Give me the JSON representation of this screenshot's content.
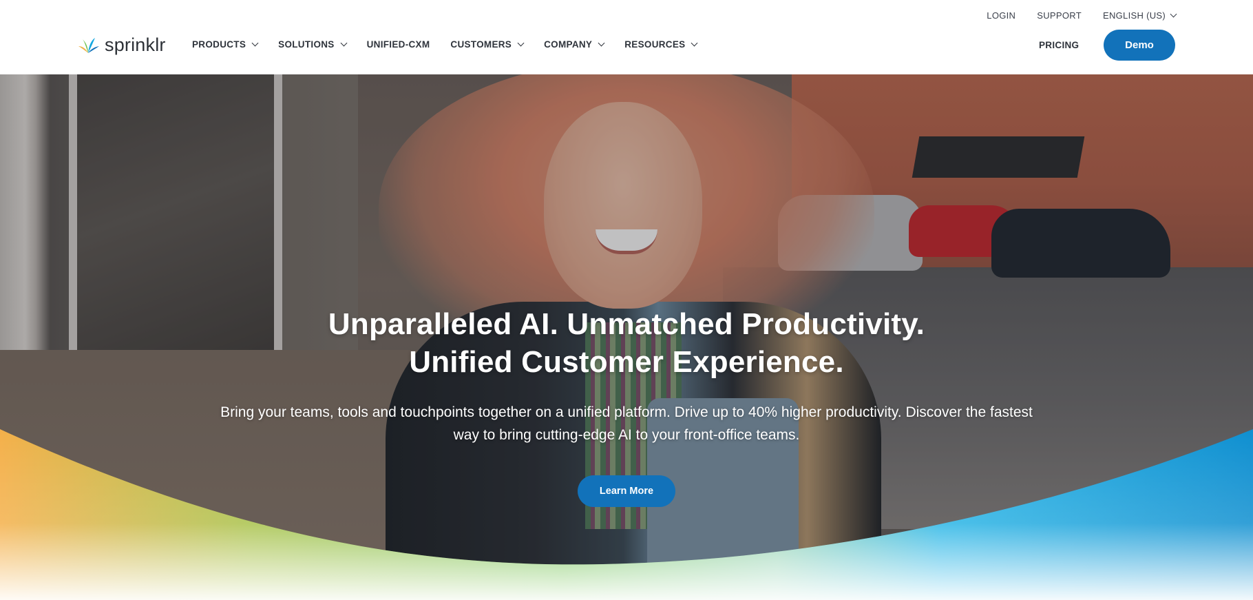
{
  "brand": {
    "name": "sprinklr"
  },
  "topbar": {
    "login": "LOGIN",
    "support": "SUPPORT",
    "language": "ENGLISH (US)"
  },
  "nav": {
    "items": [
      {
        "label": "PRODUCTS",
        "dropdown": true
      },
      {
        "label": "SOLUTIONS",
        "dropdown": true
      },
      {
        "label": "UNIFIED-CXM",
        "dropdown": false
      },
      {
        "label": "CUSTOMERS",
        "dropdown": true
      },
      {
        "label": "COMPANY",
        "dropdown": true
      },
      {
        "label": "RESOURCES",
        "dropdown": true
      }
    ],
    "pricing": "PRICING",
    "demo": "Demo"
  },
  "hero": {
    "headline_line1": "Unparalleled AI. Unmatched Productivity.",
    "headline_line2": "Unified Customer Experience.",
    "subtext": "Bring your teams, tools and touchpoints together on a unified platform. Drive up to 40% higher productivity. Discover the fastest way to bring cutting-edge AI to your front-office teams.",
    "cta": "Learn More"
  },
  "colors": {
    "primary": "#1272ba",
    "wave_orange": "#f0b34a",
    "wave_green": "#6cc04a",
    "wave_blue": "#15a8e0"
  }
}
